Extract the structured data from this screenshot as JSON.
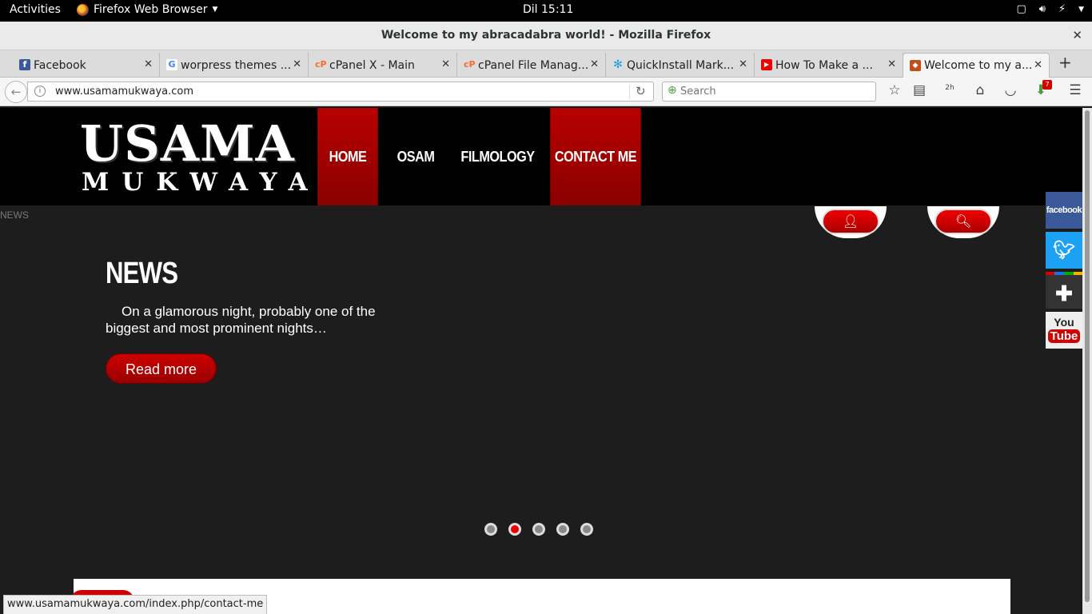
{
  "system": {
    "activities": "Activities",
    "app_menu": "Firefox Web Browser",
    "clock": "Dil 15:11"
  },
  "window": {
    "title": "Welcome to my abracadabra world! - Mozilla Firefox"
  },
  "tabs": [
    {
      "label": "Facebook",
      "favicon": "facebook-icon"
    },
    {
      "label": "worpress themes ...",
      "favicon": "google-icon"
    },
    {
      "label": "cPanel X - Main",
      "favicon": "cpanel-icon"
    },
    {
      "label": "cPanel File Manag...",
      "favicon": "cpanel-icon"
    },
    {
      "label": "QuickInstall Mark...",
      "favicon": "quickinstall-icon"
    },
    {
      "label": "How To Make a ...",
      "favicon": "youtube-icon"
    },
    {
      "label": "Welcome to my a...",
      "favicon": "site-icon",
      "active": true
    }
  ],
  "navbar": {
    "url": "www.usamamukwaya.com",
    "search_placeholder": "Search",
    "timer_label": "2h",
    "download_badge": "7"
  },
  "site": {
    "logo_line1": "USAMA",
    "logo_line2": "MUKWAYA",
    "menu": [
      {
        "label": "HOME",
        "active": true
      },
      {
        "label": "OSAM",
        "active": false
      },
      {
        "label": "FILMOLOGY",
        "active": false
      },
      {
        "label": "CONTACT ME",
        "active": true
      }
    ],
    "news_small_label": "NEWS",
    "slide": {
      "title": "NEWS",
      "text": "On a glamorous night, probably one of the biggest and most prominent nights…",
      "button": "Read more"
    },
    "slider_dots": 5,
    "active_dot": 2,
    "social": {
      "facebook": "facebook",
      "youtube_you": "You",
      "youtube_tube": "Tube"
    }
  },
  "status_url": "www.usamamukwaya.com/index.php/contact-me",
  "colors": {
    "accent_red": "#b80000",
    "header_bg": "#000000",
    "page_bg": "#1d1d1d"
  }
}
